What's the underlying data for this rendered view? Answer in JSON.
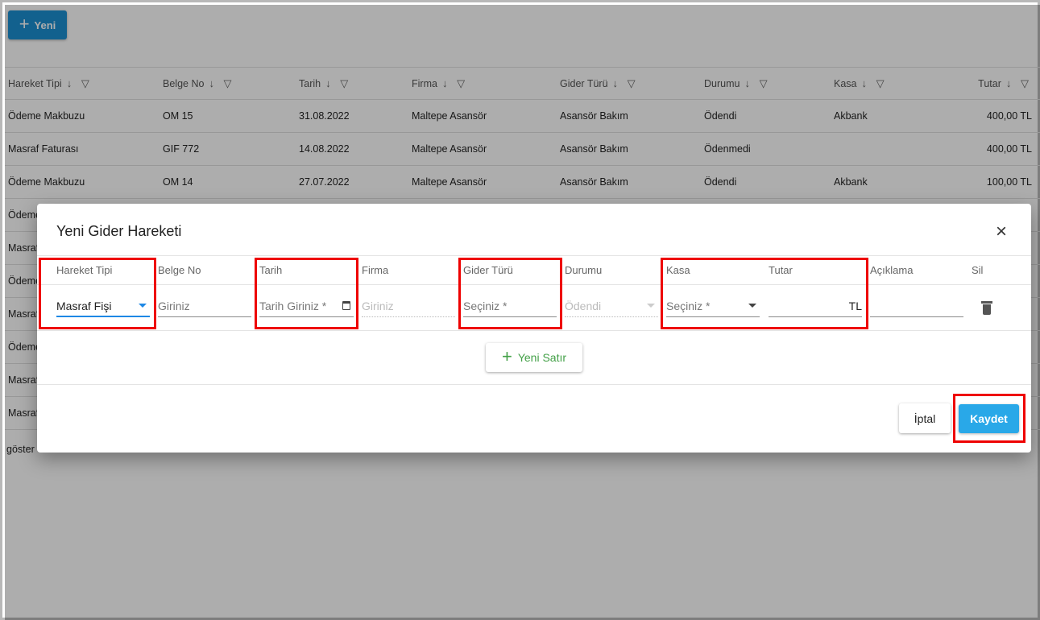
{
  "toolbar": {
    "new_label": "Yeni"
  },
  "grid": {
    "columns": [
      "Hareket Tipi",
      "Belge No",
      "Tarih",
      "Firma",
      "Gider Türü",
      "Durumu",
      "Kasa",
      "Tutar"
    ],
    "rows": [
      [
        "Ödeme Makbuzu",
        "OM 15",
        "31.08.2022",
        "Maltepe Asansör",
        "Asansör Bakım",
        "Ödendi",
        "Akbank",
        "400,00 TL"
      ],
      [
        "Masraf Faturası",
        "GIF 772",
        "14.08.2022",
        "Maltepe Asansör",
        "Asansör Bakım",
        "Ödenmedi",
        "",
        "400,00 TL"
      ],
      [
        "Ödeme Makbuzu",
        "OM 14",
        "27.07.2022",
        "Maltepe Asansör",
        "Asansör Bakım",
        "Ödendi",
        "Akbank",
        "100,00 TL"
      ],
      [
        "Ödeme",
        "",
        "",
        "",
        "",
        "",
        "",
        ""
      ],
      [
        "Masraf",
        "",
        "",
        "",
        "",
        "",
        "",
        ""
      ],
      [
        "Ödeme",
        "",
        "",
        "",
        "",
        "",
        "",
        ""
      ],
      [
        "Masraf",
        "",
        "",
        "",
        "",
        "",
        "",
        ""
      ],
      [
        "Ödeme",
        "",
        "",
        "",
        "",
        "",
        "",
        ""
      ],
      [
        "Masraf",
        "",
        "",
        "",
        "",
        "",
        "",
        ""
      ],
      [
        "Masraf",
        "",
        "",
        "",
        "",
        "",
        "",
        ""
      ]
    ],
    "pager_text": "göster"
  },
  "dialog": {
    "title": "Yeni Gider Hareketi",
    "close_icon": "close-icon",
    "columns": {
      "hareket_tipi": "Hareket Tipi",
      "belge_no": "Belge No",
      "tarih": "Tarih",
      "firma": "Firma",
      "gider_turu": "Gider Türü",
      "durumu": "Durumu",
      "kasa": "Kasa",
      "tutar": "Tutar",
      "aciklama": "Açıklama",
      "sil": "Sil"
    },
    "row": {
      "hareket_tipi_value": "Masraf Fişi",
      "belge_no_placeholder": "Giriniz",
      "tarih_placeholder": "Tarih Giriniz *",
      "firma_placeholder": "Giriniz",
      "gider_turu_placeholder": "Seçiniz *",
      "durumu_value": "Ödendi",
      "kasa_placeholder": "Seçiniz *",
      "tutar_value": "",
      "tutar_suffix": "TL",
      "aciklama_value": ""
    },
    "add_row_label": "Yeni Satır",
    "cancel_label": "İptal",
    "save_label": "Kaydet"
  },
  "colors": {
    "primary": "#1b8fd2",
    "save": "#29a8e8",
    "add_row": "#43a047",
    "highlight": "#ee0000"
  }
}
